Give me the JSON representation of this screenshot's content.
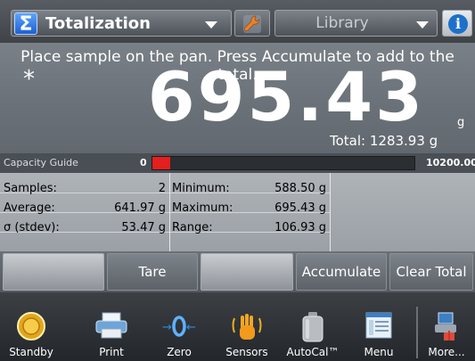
{
  "header": {
    "app_icon": "sigma-icon",
    "app_label": "Totalization",
    "library_label": "Library",
    "settings_icon": "wrench-icon",
    "info_icon": "info-icon"
  },
  "display": {
    "prompt": "Place sample on the pan.  Press Accumulate to add to the total.",
    "stable_indicator": "*",
    "weight": "695.43",
    "unit": "g",
    "total": "Total: 1283.93 g"
  },
  "capacity_guide": {
    "label": "Capacity Guide",
    "min": "0",
    "max": "10200.00",
    "fill_fraction": 0.068,
    "fill_color": "#e51e1e"
  },
  "stats": {
    "samples_label": "Samples:",
    "samples_value": "2",
    "average_label": "Average:",
    "average_value": "641.97 g",
    "stdev_label": "σ (stdev):",
    "stdev_value": "53.47 g",
    "minimum_label": "Minimum:",
    "minimum_value": "588.50 g",
    "maximum_label": "Maximum:",
    "maximum_value": "695.43 g",
    "range_label": "Range:",
    "range_value": "106.93 g"
  },
  "actions": {
    "tare": "Tare",
    "accumulate": "Accumulate",
    "clear_total": "Clear Total"
  },
  "toolbar": [
    {
      "label": "Standby",
      "icon": "standby-icon"
    },
    {
      "label": "Print",
      "icon": "printer-icon"
    },
    {
      "label": "Zero",
      "icon": "zero-icon"
    },
    {
      "label": "Sensors",
      "icon": "hand-sensor-icon"
    },
    {
      "label": "AutoCal™",
      "icon": "calibration-weight-icon"
    },
    {
      "label": "Menu",
      "icon": "menu-icon"
    },
    {
      "label": "More...",
      "icon": "more-icon"
    }
  ]
}
